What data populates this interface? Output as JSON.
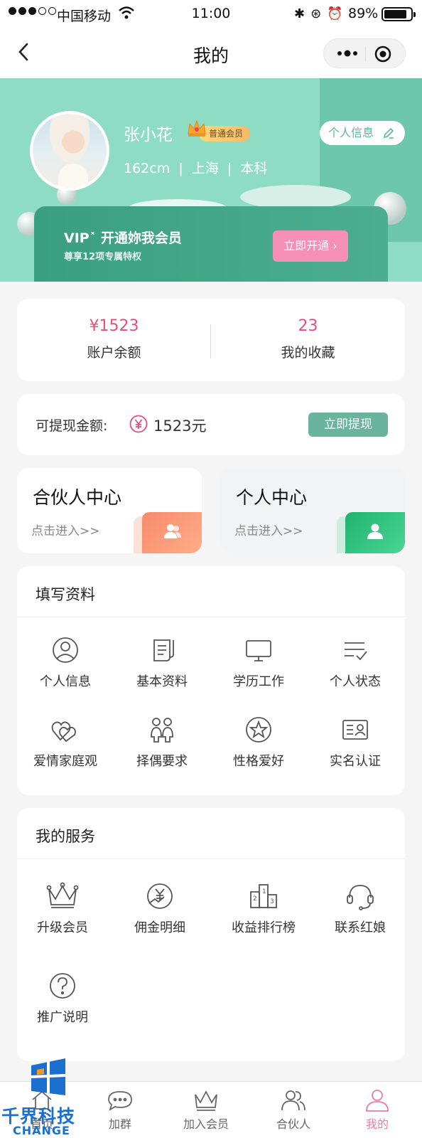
{
  "status_bar": {
    "carrier": "中国移动",
    "time": "11:00",
    "battery": "89%",
    "battery_level": 0.89
  },
  "nav": {
    "title": "我的"
  },
  "profile": {
    "name": "张小花",
    "membership": "普通会员",
    "height": "162cm",
    "city": "上海",
    "education": "本科",
    "info_button": "个人信息"
  },
  "vip": {
    "title": "VIP˟ 开通妳我会员",
    "subtitle": "尊享12项专属特权",
    "button": "立即开通 ›"
  },
  "stats": {
    "balance_value": "¥1523",
    "balance_label": "账户余额",
    "favorites_value": "23",
    "favorites_label": "我的收藏"
  },
  "withdraw": {
    "label": "可提现金额:",
    "amount": "1523元",
    "button": "立即提现"
  },
  "centers": {
    "partner": {
      "title": "合伙人中心",
      "subtitle": "点击进入>>"
    },
    "personal": {
      "title": "个人中心",
      "subtitle": "点击进入>>"
    }
  },
  "profile_section": {
    "title": "填写资料",
    "items": [
      {
        "label": "个人信息",
        "icon": "user-circle-icon"
      },
      {
        "label": "基本资料",
        "icon": "document-icon"
      },
      {
        "label": "学历工作",
        "icon": "monitor-icon"
      },
      {
        "label": "个人状态",
        "icon": "checklist-icon"
      },
      {
        "label": "爱情家庭观",
        "icon": "hearts-icon"
      },
      {
        "label": "择偶要求",
        "icon": "couple-icon"
      },
      {
        "label": "性格爱好",
        "icon": "star-circle-icon"
      },
      {
        "label": "实名认证",
        "icon": "id-card-icon"
      }
    ]
  },
  "service_section": {
    "title": "我的服务",
    "items": [
      {
        "label": "升级会员",
        "icon": "crown-icon"
      },
      {
        "label": "佣金明细",
        "icon": "yen-chart-icon"
      },
      {
        "label": "收益排行榜",
        "icon": "podium-icon"
      },
      {
        "label": "联系红娘",
        "icon": "headset-icon"
      },
      {
        "label": "推广说明",
        "icon": "question-icon"
      }
    ]
  },
  "tabbar": {
    "items": [
      {
        "label": "首页",
        "icon": "home-icon"
      },
      {
        "label": "加群",
        "icon": "chat-icon"
      },
      {
        "label": "加入会员",
        "icon": "crown-icon"
      },
      {
        "label": "合伙人",
        "icon": "partners-icon"
      },
      {
        "label": "我的",
        "icon": "person-icon"
      }
    ],
    "active_index": 4
  },
  "watermark": {
    "text": "千界科技",
    "sub": "CHANGE"
  },
  "colors": {
    "accent_pink": "#e84d7e",
    "brand_green": "#8fdcc4",
    "dark_green": "#3a9e80",
    "active_tab": "#f07aa2"
  }
}
